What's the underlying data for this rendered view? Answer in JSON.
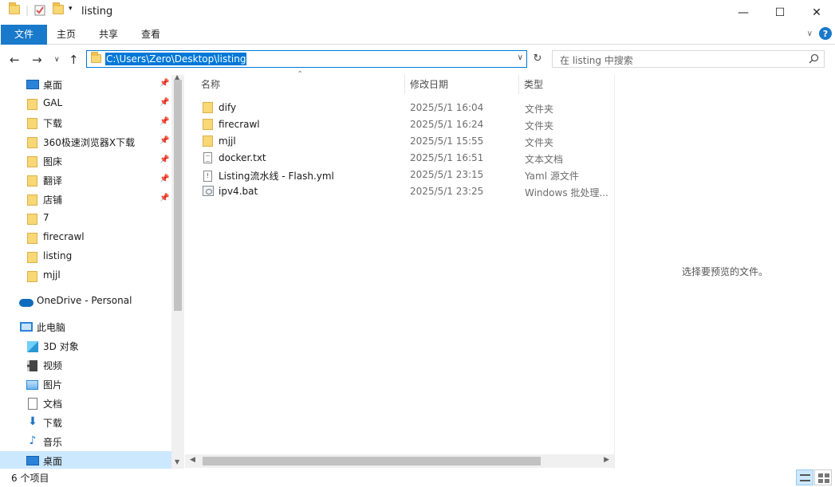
{
  "window": {
    "title": "listing",
    "controls": {
      "minimize": "—",
      "maximize": "☐",
      "close": "✕"
    }
  },
  "ribbon": {
    "tabs": [
      {
        "label": "文件",
        "active": true
      },
      {
        "label": "主页"
      },
      {
        "label": "共享"
      },
      {
        "label": "查看"
      }
    ],
    "help": "?"
  },
  "address": {
    "path": "C:\\Users\\Zero\\Desktop\\listing",
    "search_placeholder": "在 listing 中搜索"
  },
  "nav": {
    "quick_access": [
      {
        "label": "桌面",
        "icon": "desktop-icon",
        "pinned": true
      },
      {
        "label": "GAL",
        "icon": "folder-icon",
        "pinned": true
      },
      {
        "label": "下载",
        "icon": "folder-icon",
        "pinned": true
      },
      {
        "label": "360极速浏览器X下载",
        "icon": "folder-icon",
        "pinned": true
      },
      {
        "label": "图床",
        "icon": "folder-icon",
        "pinned": true
      },
      {
        "label": "翻译",
        "icon": "folder-icon",
        "pinned": true
      },
      {
        "label": "店铺",
        "icon": "folder-icon",
        "pinned": true
      },
      {
        "label": "7",
        "icon": "folder-icon",
        "pinned": false
      },
      {
        "label": "firecrawl",
        "icon": "folder-icon",
        "pinned": false
      },
      {
        "label": "listing",
        "icon": "folder-icon",
        "pinned": false
      },
      {
        "label": "mjjl",
        "icon": "folder-icon",
        "pinned": false
      }
    ],
    "onedrive": "OneDrive - Personal",
    "this_pc": "此电脑",
    "pc_items": [
      {
        "label": "3D 对象",
        "icon": "3d-objects-icon"
      },
      {
        "label": "视频",
        "icon": "videos-icon"
      },
      {
        "label": "图片",
        "icon": "pictures-icon"
      },
      {
        "label": "文档",
        "icon": "documents-icon"
      },
      {
        "label": "下载",
        "icon": "downloads-icon"
      },
      {
        "label": "音乐",
        "icon": "music-icon"
      },
      {
        "label": "桌面",
        "icon": "desktop-icon",
        "selected": true
      }
    ]
  },
  "columns": {
    "name": "名称",
    "date": "修改日期",
    "type": "类型"
  },
  "files": [
    {
      "name": "dify",
      "date": "2025/5/1 16:04",
      "type": "文件夹",
      "icon": "folder-icon"
    },
    {
      "name": "firecrawl",
      "date": "2025/5/1 16:24",
      "type": "文件夹",
      "icon": "folder-icon"
    },
    {
      "name": "mjjl",
      "date": "2025/5/1 15:55",
      "type": "文件夹",
      "icon": "folder-icon"
    },
    {
      "name": "docker.txt",
      "date": "2025/5/1 16:51",
      "type": "文本文档",
      "icon": "text-file-icon"
    },
    {
      "name": "Listing流水线 - Flash.yml",
      "date": "2025/5/1 23:15",
      "type": "Yaml 源文件",
      "icon": "yaml-file-icon"
    },
    {
      "name": "ipv4.bat",
      "date": "2025/5/1 23:25",
      "type": "Windows 批处理...",
      "icon": "batch-file-icon"
    }
  ],
  "preview": {
    "message": "选择要预览的文件。"
  },
  "status": {
    "count": "6 个项目"
  }
}
